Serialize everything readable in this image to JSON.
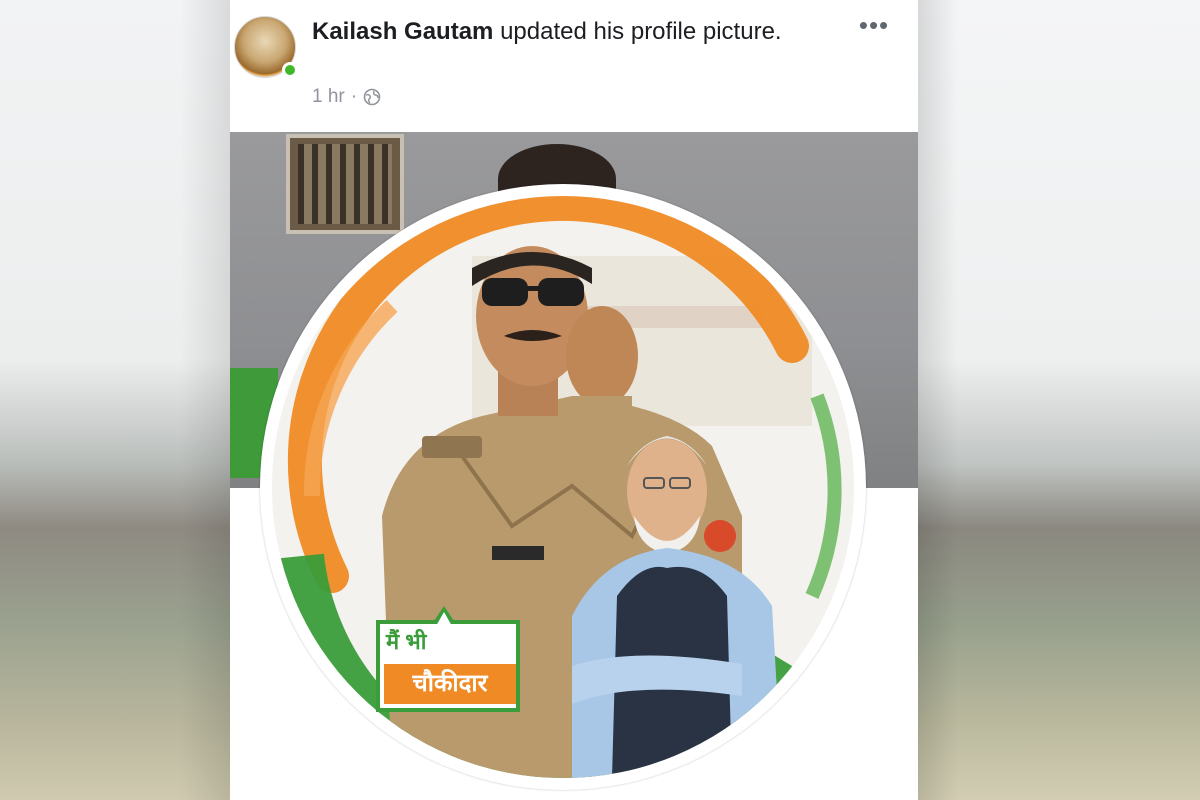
{
  "post": {
    "author_name": "Kailash Gautam",
    "action_text": " updated his profile picture.",
    "timestamp": "1 hr",
    "separator": "·",
    "privacy_icon": "globe-icon",
    "more_label": "•••"
  },
  "profile_frame": {
    "badge_line1": "मैं भी",
    "badge_line2": "चौकीदार"
  },
  "colors": {
    "saffron": "#f08a24",
    "green": "#3a9d3a",
    "online": "#42b72a"
  }
}
